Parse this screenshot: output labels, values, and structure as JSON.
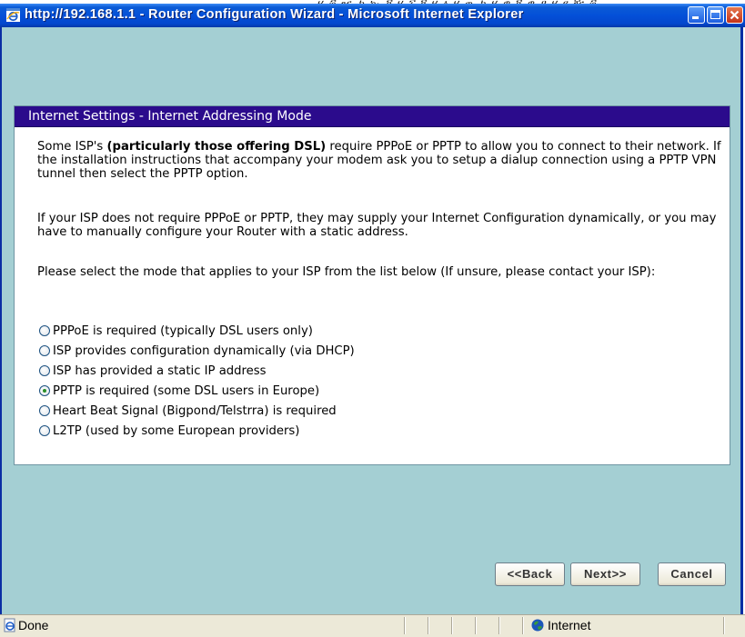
{
  "window": {
    "title": "http://192.168.1.1 - Router Configuration Wizard - Microsoft Internet Explorer",
    "accent": "#0450d8"
  },
  "panel": {
    "header": "Internet Settings - Internet Addressing Mode",
    "header_color": "#2b0b8c",
    "para1_pre": "Some ISP's ",
    "para1_bold": "(particularly those offering DSL)",
    "para1_post": " require PPPoE or PPTP to allow you to connect to their network. If the installation instructions that accompany your modem ask you to setup a dialup connection using a PPTP VPN tunnel then select the PPTP option.",
    "para2": "If your ISP does not require PPPoE or PPTP, they may supply your Internet Configuration dynamically, or you may have to manually configure your Router with a static address.",
    "para3": "Please select the mode that applies to your ISP from the list below (If unsure, please contact your ISP):",
    "options": [
      {
        "label": "PPPoE is required (typically DSL users only)",
        "checked": false
      },
      {
        "label": "ISP provides configuration dynamically (via DHCP)",
        "checked": false
      },
      {
        "label": "ISP has provided a static IP address",
        "checked": false
      },
      {
        "label": "PPTP is required (some DSL users in Europe)",
        "checked": true
      },
      {
        "label": "Heart Beat Signal (Bigpond/Telstrra) is required",
        "checked": false
      },
      {
        "label": "L2TP (used by some European providers)",
        "checked": false
      }
    ]
  },
  "buttons": {
    "back": "<<Back",
    "next": "Next>>",
    "cancel": "Cancel"
  },
  "status": {
    "left": "Done",
    "zone": "Internet"
  },
  "colors": {
    "window_bg": "#a4cfd3"
  }
}
